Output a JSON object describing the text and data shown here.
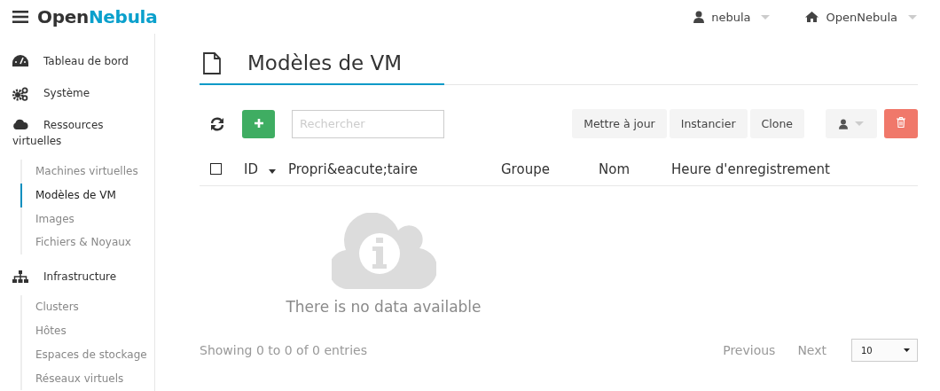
{
  "header": {
    "logo_first": "Open",
    "logo_second": "Nebula",
    "user": "nebula",
    "zone": "OpenNebula"
  },
  "sidebar": [
    {
      "label": "Tableau de bord"
    },
    {
      "label": "Système"
    },
    {
      "label": "Ressources virtuelles",
      "children": [
        {
          "label": "Machines virtuelles",
          "selected": false
        },
        {
          "label": "Modèles de VM",
          "selected": true
        },
        {
          "label": "Images",
          "selected": false
        },
        {
          "label": "Fichiers & Noyaux",
          "selected": false
        }
      ]
    },
    {
      "label": "Infrastructure",
      "children": [
        {
          "label": "Clusters",
          "selected": false
        },
        {
          "label": "Hôtes",
          "selected": false
        },
        {
          "label": "Espaces de stockage",
          "selected": false
        },
        {
          "label": "Réseaux virtuels",
          "selected": false
        }
      ]
    }
  ],
  "page_title": "Modèles de VM",
  "toolbar": {
    "search": {
      "placeholder": "Rechercher"
    },
    "buttons": [
      "Mettre à jour",
      "Instancier",
      "Clone"
    ]
  },
  "table": {
    "select_all": {
      "checked": false
    },
    "columns": [
      {
        "label": "ID",
        "sorted": true
      },
      {
        "label": "Propri&eacute;taire",
        "sorted": false
      },
      {
        "label": "Groupe",
        "sorted": false
      },
      {
        "label": "Nom",
        "sorted": false
      },
      {
        "label": "Heure d'enregistrement",
        "sorted": false
      }
    ],
    "empty_message": "There is no data available"
  },
  "footer": {
    "info": "Showing 0 to 0 of 0 entries",
    "previous": "Previous",
    "next": "Next",
    "page_size": "10"
  }
}
